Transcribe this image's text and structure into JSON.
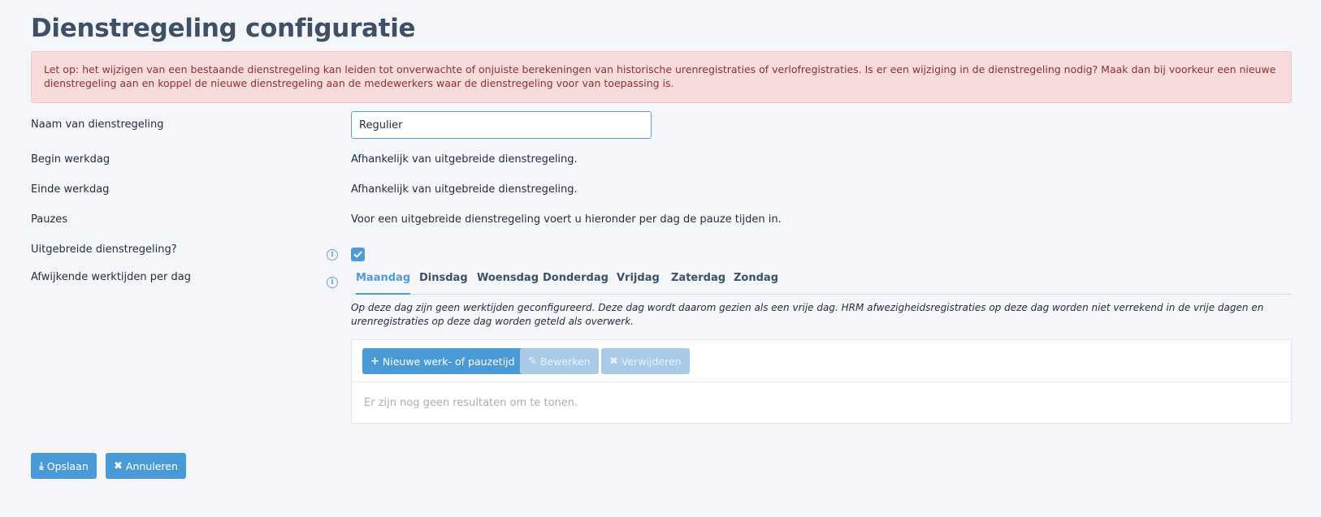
{
  "page": {
    "title": "Dienstregeling configuratie"
  },
  "alert": {
    "text": "Let op: het wijzigen van een bestaande dienstregeling kan leiden tot onverwachte of onjuiste berekeningen van historische urenregistraties of verlofregistraties. Is er een wijziging in de dienstregeling nodig? Maak dan bij voorkeur een nieuwe dienstregeling aan en koppel de nieuwe dienstregeling aan de medewerkers waar de dienstregeling voor van toepassing is."
  },
  "form": {
    "name_label": "Naam van dienstregeling",
    "name_value": "Regulier",
    "begin_label": "Begin werkdag",
    "begin_value": "Afhankelijk van uitgebreide dienstregeling.",
    "end_label": "Einde werkdag",
    "end_value": "Afhankelijk van uitgebreide dienstregeling.",
    "breaks_label": "Pauzes",
    "breaks_value": "Voor een uitgebreide dienstregeling voert u hieronder per dag de pauze tijden in.",
    "extended_label": "Uitgebreide dienstregeling?",
    "extended_checked": true,
    "deviating_label": "Afwijkende werktijden per dag"
  },
  "tabs": [
    {
      "label": "Maandag",
      "active": true
    },
    {
      "label": "Dinsdag",
      "active": false
    },
    {
      "label": "Woensdag",
      "active": false
    },
    {
      "label": "Donderdag",
      "active": false
    },
    {
      "label": "Vrijdag",
      "active": false
    },
    {
      "label": "Zaterdag",
      "active": false
    },
    {
      "label": "Zondag",
      "active": false
    }
  ],
  "day_note": "Op deze dag zijn geen werktijden geconfigureerd. Deze dag wordt daarom gezien als een vrije dag. HRM afwezigheidsregistraties op deze dag worden niet verrekend in de vrije dagen en urenregistraties op deze dag worden geteld als overwerk.",
  "toolbar": {
    "new_label": "Nieuwe werk- of pauzetijd",
    "edit_label": "Bewerken",
    "delete_label": "Verwijderen"
  },
  "table": {
    "empty_text": "Er zijn nog geen resultaten om te tonen."
  },
  "footer": {
    "save_label": "Opslaan",
    "cancel_label": "Annuleren"
  },
  "icons": {
    "info": "info-icon",
    "check": "check-icon",
    "plus": "plus-icon",
    "edit": "edit-icon",
    "delete": "close-icon",
    "save": "download-icon",
    "cancel": "close-icon"
  },
  "colors": {
    "accent": "#4a9ad8",
    "alert_bg": "#f8dcdc",
    "alert_text": "#8e2f2f",
    "title": "#3d5066"
  }
}
